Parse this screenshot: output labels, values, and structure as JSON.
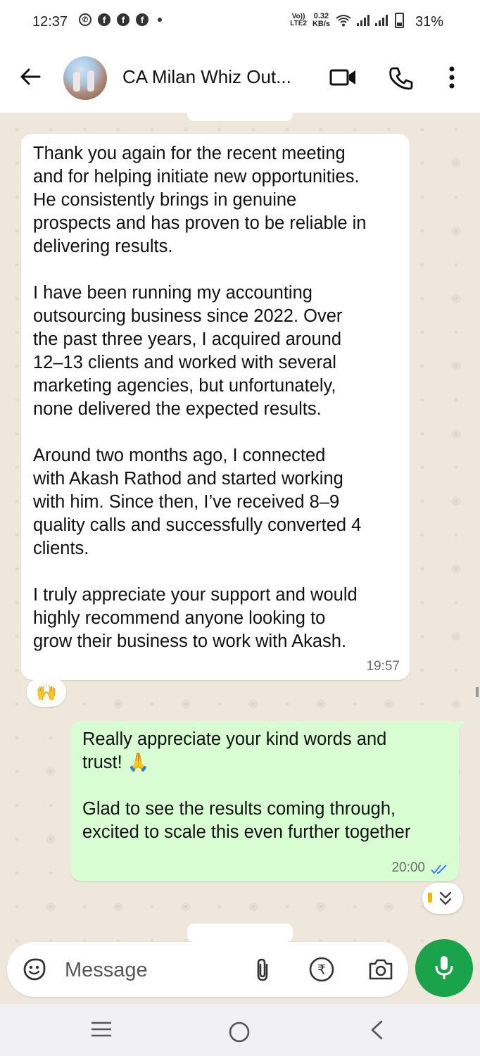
{
  "status_bar": {
    "time": "12:37",
    "volte_top": "Vo))",
    "volte_bottom": "LTE2",
    "speed_value": "0.32",
    "speed_unit": "KB/s",
    "battery": "31%"
  },
  "header": {
    "contact_name": "CA Milan Whiz Out...",
    "icons": [
      "back-arrow-icon",
      "video-call-icon",
      "voice-call-icon",
      "more-vert-icon"
    ]
  },
  "messages": [
    {
      "direction": "incoming",
      "text": "Thank you again for the recent meeting\nand for helping initiate new opportunities.\nHe consistently brings in genuine\nprospects and has proven to be reliable in\ndelivering results.\n\nI have been running my accounting\noutsourcing business since 2022. Over\nthe past three years, I acquired around\n12–13 clients and worked with several\nmarketing agencies, but unfortunately,\nnone delivered the expected results.\n\nAround two months ago, I connected\nwith Akash Rathod and started working\nwith him. Since then, I’ve received 8–9\nquality calls and successfully converted 4\nclients.\n\nI truly appreciate your support and would\nhighly recommend anyone looking to\ngrow their business to work with Akash.",
      "time": "19:57",
      "reaction": "🙌"
    },
    {
      "direction": "outgoing",
      "text": "Really appreciate your kind words and\ntrust! 🙏\n\nGlad to see the results coming through,\nexcited to scale this even further together",
      "time": "20:00",
      "status": "read"
    }
  ],
  "composer": {
    "placeholder": "Message",
    "icons": [
      "emoji-icon",
      "attach-icon",
      "payment-rupee-icon",
      "camera-icon",
      "mic-icon"
    ]
  },
  "colors": {
    "outgoing_bubble": "#d8fdd2",
    "accent_green": "#1aa34a",
    "read_tick": "#3b82f6"
  }
}
